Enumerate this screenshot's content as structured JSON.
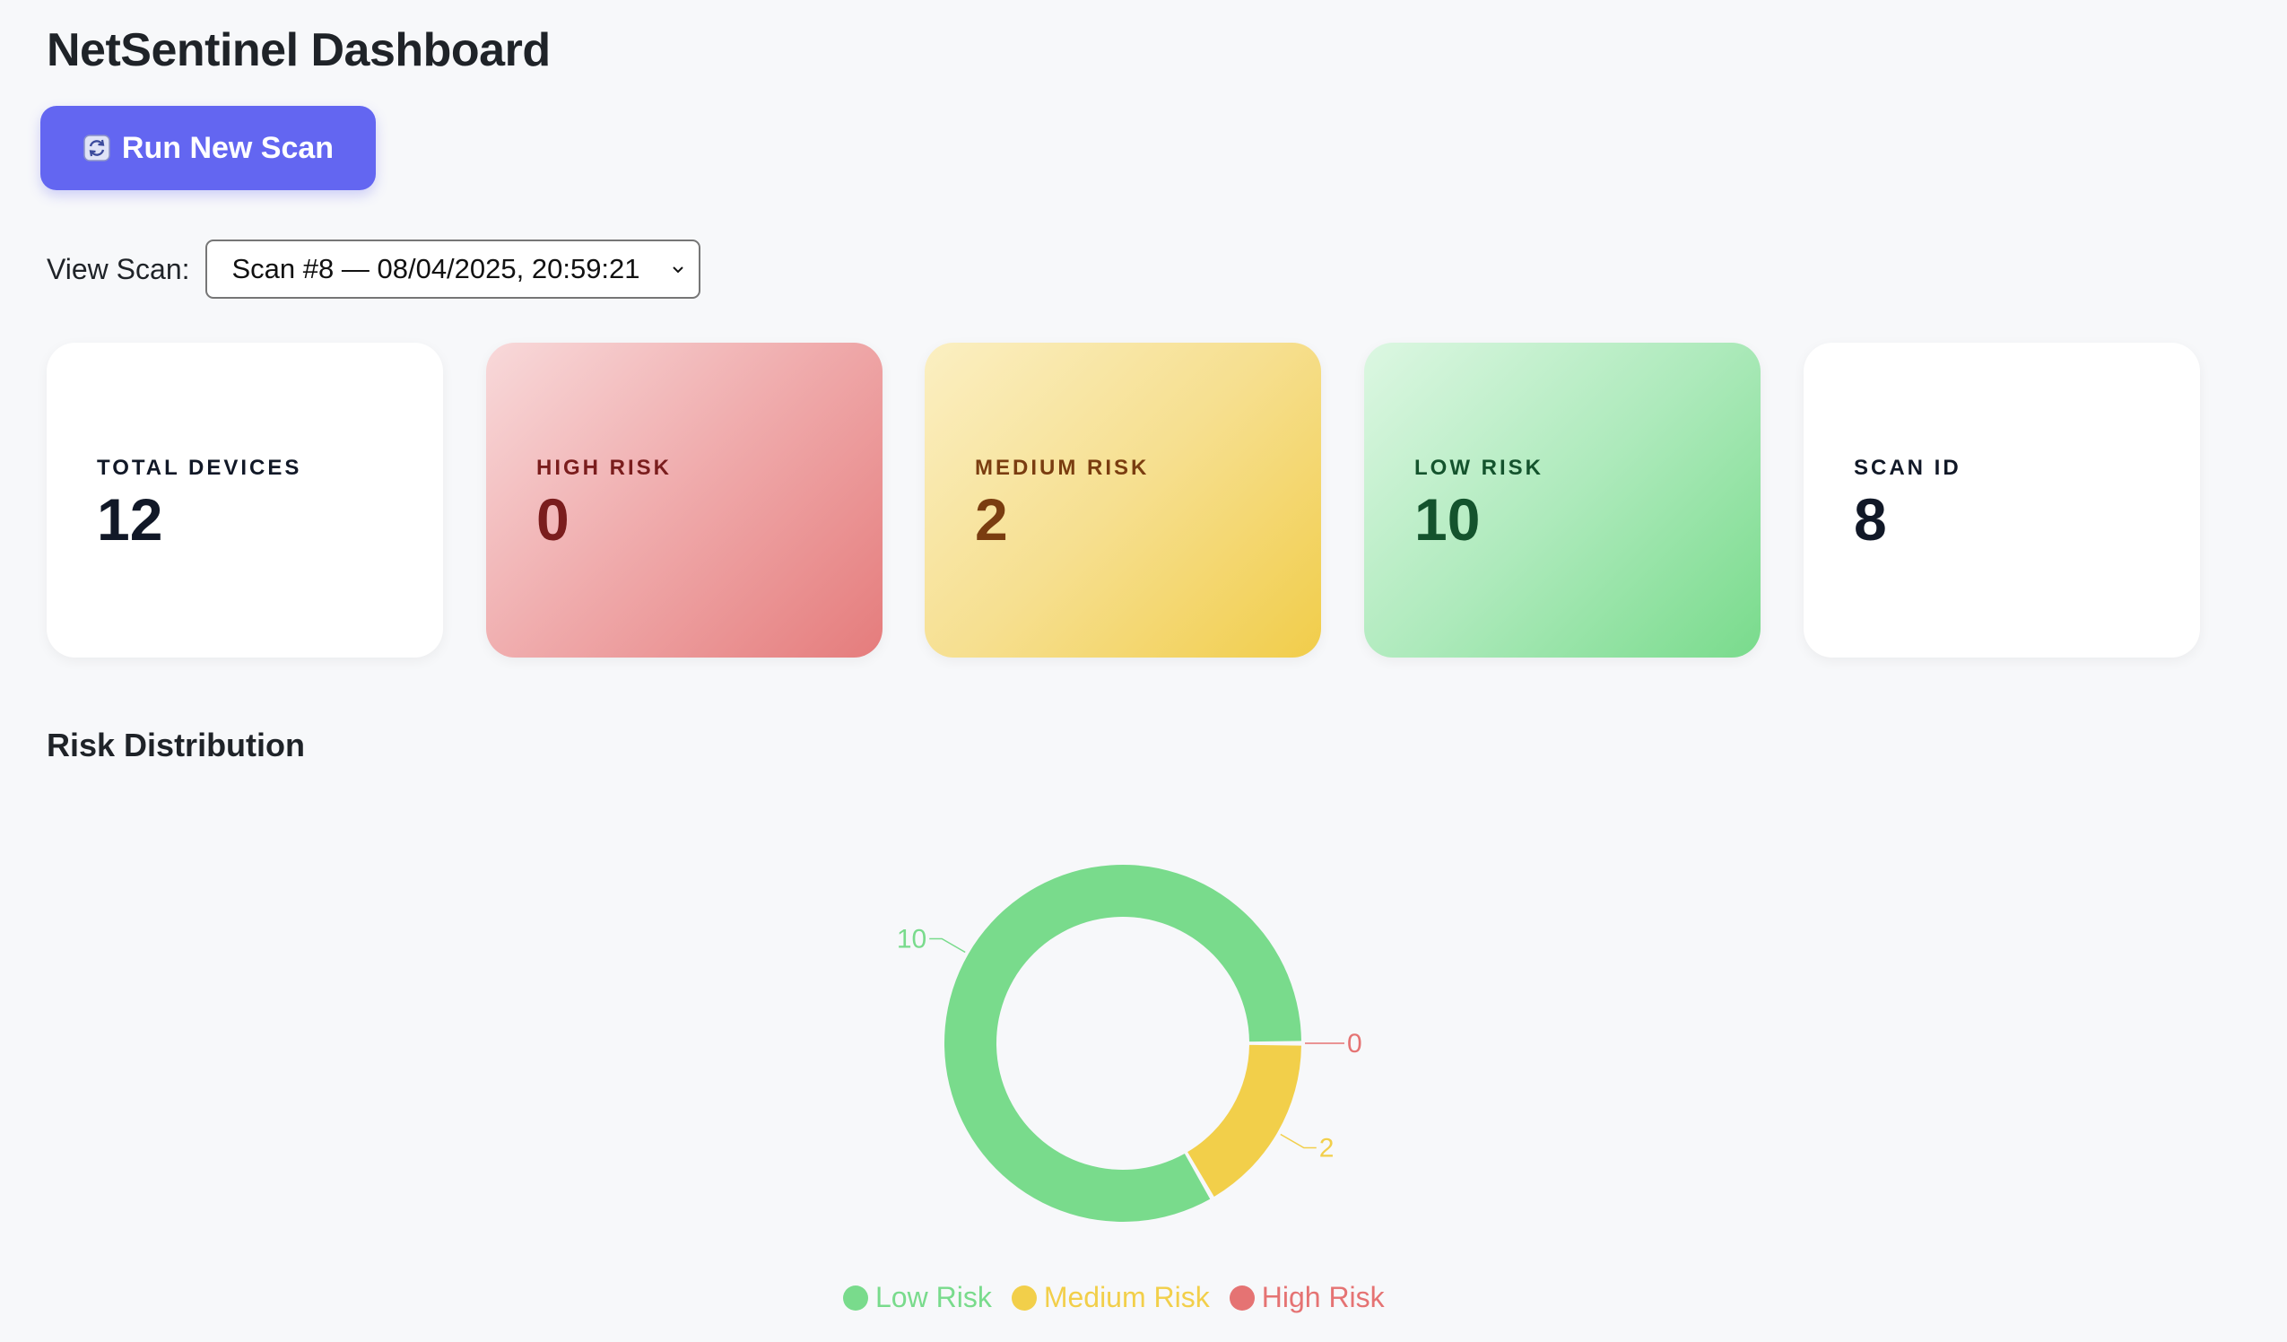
{
  "header": {
    "title": "NetSentinel Dashboard"
  },
  "toolbar": {
    "run_scan_label": "Run New Scan",
    "run_scan_icon": "refresh-icon"
  },
  "scan_selector": {
    "label": "View Scan:",
    "selected": "Scan #8 — 08/04/2025, 20:59:21"
  },
  "cards": {
    "total": {
      "label": "TOTAL DEVICES",
      "value": "12"
    },
    "high": {
      "label": "HIGH RISK",
      "value": "0"
    },
    "medium": {
      "label": "MEDIUM RISK",
      "value": "2"
    },
    "low": {
      "label": "LOW RISK",
      "value": "10"
    },
    "scan": {
      "label": "SCAN ID",
      "value": "8"
    }
  },
  "section": {
    "title": "Risk Distribution"
  },
  "colors": {
    "accent": "#6366f1",
    "low": "#79db8c",
    "medium": "#f2cf4a",
    "high": "#e57373"
  },
  "chart_data": {
    "type": "pie",
    "subtype": "donut",
    "title": "Risk Distribution",
    "categories": [
      "High Risk",
      "Medium Risk",
      "Low Risk"
    ],
    "values": [
      0,
      2,
      10
    ],
    "colors": [
      "#e57373",
      "#f2cf4a",
      "#79db8c"
    ],
    "data_labels": [
      "0",
      "2",
      "10"
    ],
    "legend": {
      "position": "bottom",
      "entries": [
        "Low Risk",
        "Medium Risk",
        "High Risk"
      ]
    }
  }
}
